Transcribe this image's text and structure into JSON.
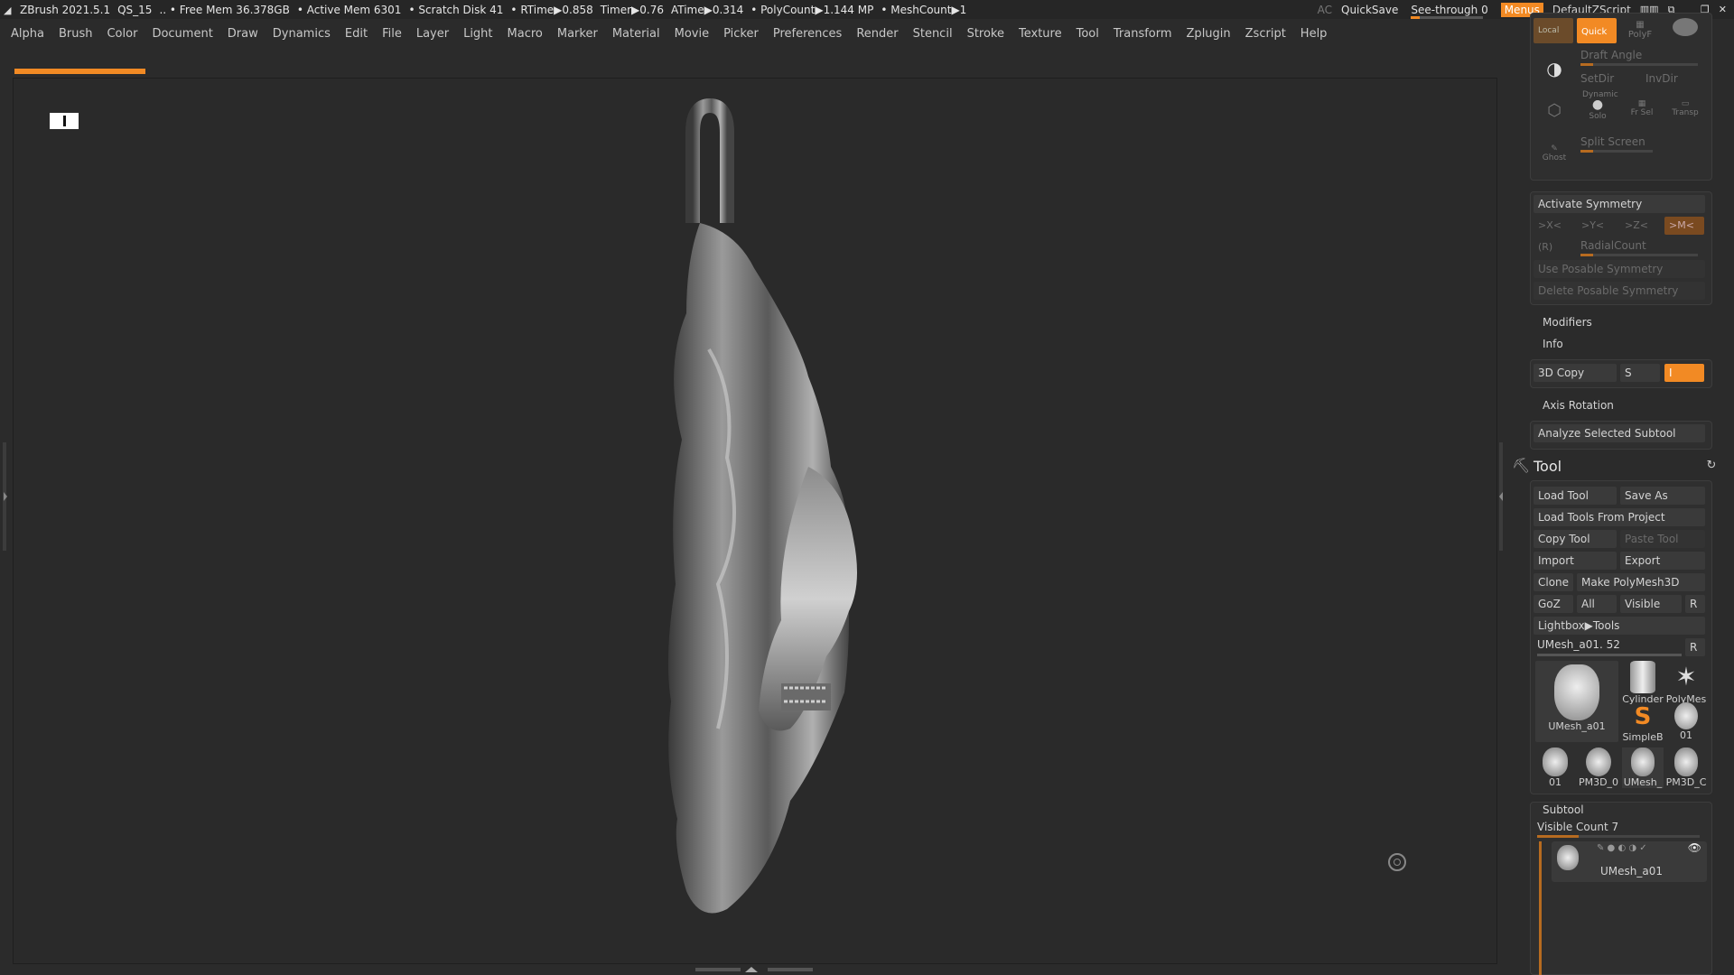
{
  "titlebar": {
    "app": "ZBrush 2021.5.1",
    "doc": "QS_15",
    "stats": [
      ".. • Free Mem 36.378GB",
      "• Active Mem 6301",
      "• Scratch Disk 41",
      "• RTime▶0.858",
      "Timer▶0.76",
      "ATime▶0.314",
      "• PolyCount▶1.144 MP",
      "• MeshCount▶1"
    ],
    "ac": "AC",
    "quicksave": "QuickSave",
    "seethrough": "See-through  0",
    "menus": "Menus",
    "script": "DefaultZScript"
  },
  "menubar": {
    "items": [
      "Alpha",
      "Brush",
      "Color",
      "Document",
      "Draw",
      "Dynamics",
      "Edit",
      "File",
      "Layer",
      "Light",
      "Macro",
      "Marker",
      "Material",
      "Movie",
      "Picker",
      "Preferences",
      "Render",
      "Stencil",
      "Stroke",
      "Texture",
      "Tool",
      "Transform",
      "Zplugin",
      "Zscript",
      "Help"
    ]
  },
  "top_icons": {
    "local": "Local",
    "quick": "Quick",
    "polyf": "PolyF",
    "draft_angle": "Draft Angle",
    "setdir": "SetDir",
    "invdir": "InvDir",
    "dynamic": "Dynamic",
    "solo": "Solo",
    "frsel": "Fr Sel",
    "transp": "Transp",
    "ghost": "Ghost",
    "split_screen": "Split Screen"
  },
  "symmetry": {
    "activate": "Activate Symmetry",
    "x": ">X<",
    "y": ">Y<",
    "z": ">Z<",
    "m": ">M<",
    "r": "(R)",
    "radial": "RadialCount",
    "use_posable": "Use Posable Symmetry",
    "delete_posable": "Delete Posable Symmetry"
  },
  "transform": {
    "modifiers": "Modifiers",
    "info": "Info",
    "copy3d": "3D Copy",
    "s": "S",
    "i": "I",
    "axis_rotation": "Axis Rotation",
    "analyze": "Analyze Selected Subtool"
  },
  "tool": {
    "title": "Tool",
    "load_tool": "Load Tool",
    "save_as": "Save As",
    "load_from_project": "Load Tools From Project",
    "copy_tool": "Copy Tool",
    "paste_tool": "Paste Tool",
    "import": "Import",
    "export": "Export",
    "clone": "Clone",
    "make_polymesh": "Make PolyMesh3D",
    "goz": "GoZ",
    "all": "All",
    "visible": "Visible",
    "r": "R",
    "lightbox": "Lightbox▶Tools",
    "current": "UMesh_a01. 52",
    "r2": "R",
    "thumbs": {
      "main": "UMesh_a01",
      "cylinder": "Cylinder",
      "polymesh": "PolyMes",
      "simpleb": "SimpleB",
      "t01a": "01",
      "row3": [
        "01",
        "PM3D_0",
        "UMesh_",
        "PM3D_C"
      ]
    }
  },
  "subtool": {
    "title": "Subtool",
    "visible_count": "Visible Count 7",
    "item": "UMesh_a01"
  }
}
